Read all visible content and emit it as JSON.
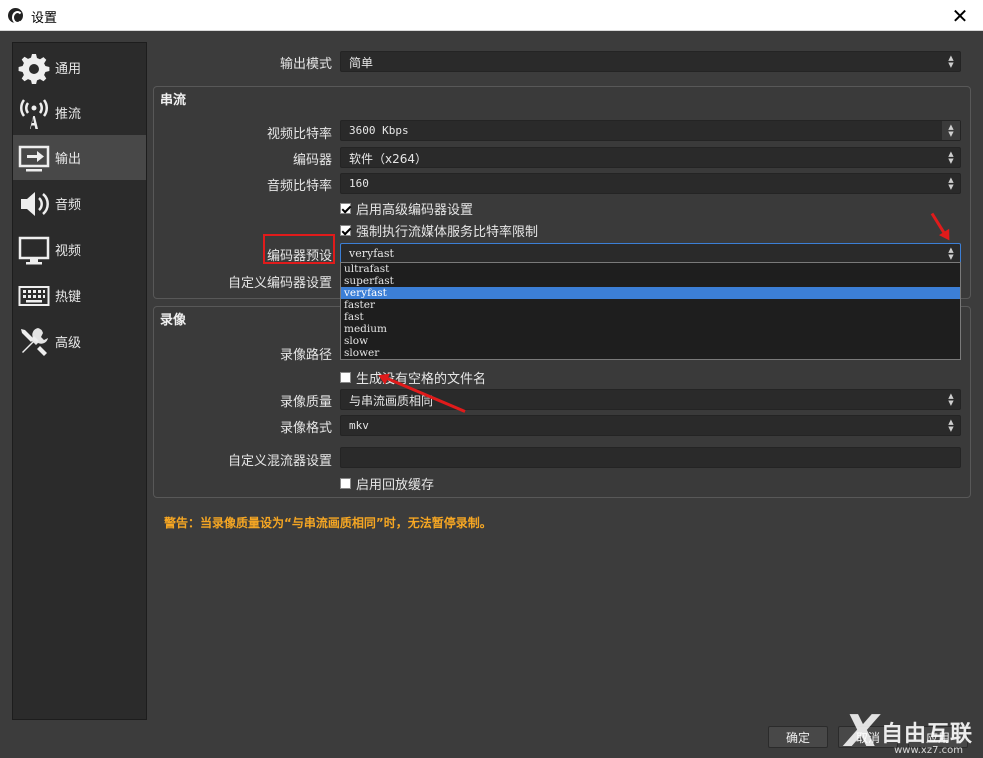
{
  "window": {
    "title": "设置",
    "close_glyph": "✕"
  },
  "sidebar": {
    "items": [
      {
        "label": "通用",
        "icon": "gear-icon",
        "active": false
      },
      {
        "label": "推流",
        "icon": "broadcast-icon",
        "active": false
      },
      {
        "label": "输出",
        "icon": "output-monitor-icon",
        "active": true
      },
      {
        "label": "音频",
        "icon": "speaker-icon",
        "active": false
      },
      {
        "label": "视频",
        "icon": "monitor-icon",
        "active": false
      },
      {
        "label": "热键",
        "icon": "keyboard-icon",
        "active": false
      },
      {
        "label": "高级",
        "icon": "tools-icon",
        "active": false
      }
    ]
  },
  "output_mode": {
    "label": "输出模式",
    "value": "简单"
  },
  "streaming": {
    "title": "串流",
    "video_bitrate": {
      "label": "视频比特率",
      "value": "3600 Kbps"
    },
    "encoder": {
      "label": "编码器",
      "value": "软件（x264）"
    },
    "audio_bitrate": {
      "label": "音频比特率",
      "value": "160"
    },
    "advanced_encoder": {
      "label": "启用高级编码器设置",
      "checked": true
    },
    "enforce_limits": {
      "label": "强制执行流媒体服务比特率限制",
      "checked": true
    },
    "preset": {
      "label": "编码器预设",
      "value": "veryfast",
      "options": [
        "ultrafast",
        "superfast",
        "veryfast",
        "faster",
        "fast",
        "medium",
        "slow",
        "slower"
      ],
      "selected_index": 2
    },
    "custom_encoder": {
      "label": "自定义编码器设置"
    }
  },
  "recording": {
    "title": "录像",
    "path": {
      "label": "录像路径"
    },
    "no_space": {
      "label": "生成没有空格的文件名",
      "checked": false
    },
    "quality": {
      "label": "录像质量",
      "value": "与串流画质相同"
    },
    "format": {
      "label": "录像格式",
      "value": "mkv"
    },
    "custom_muxer": {
      "label": "自定义混流器设置",
      "value": ""
    },
    "replay_buffer": {
      "label": "启用回放缓存",
      "checked": false
    }
  },
  "warning": "警告：当录像质量设为“与串流画质相同”时，无法暂停录制。",
  "buttons": {
    "ok": "确定",
    "cancel": "取消",
    "apply": "应用"
  },
  "watermark": {
    "mark": "X",
    "text": "自由互联",
    "url": "www.xz7.com"
  },
  "colors": {
    "accent": "#3c7fd6",
    "warning": "#f5a623",
    "annotation": "#e01b1b"
  }
}
